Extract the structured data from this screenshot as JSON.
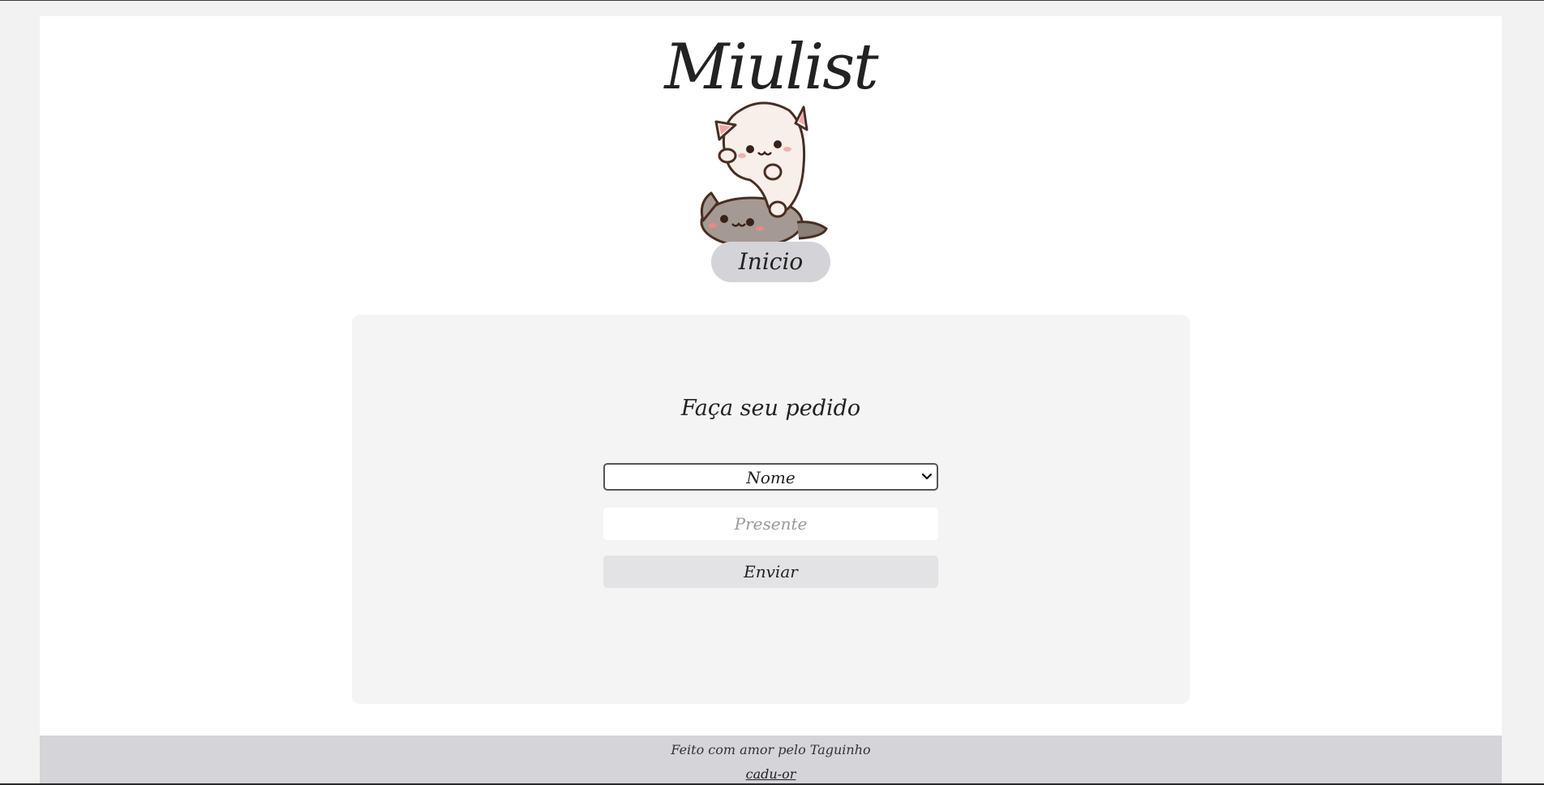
{
  "header": {
    "title": "Miulist",
    "home_label": "Inicio"
  },
  "form": {
    "heading": "Faça seu pedido",
    "name_select_value": "Nome",
    "gift_placeholder": "Presente",
    "submit_label": "Enviar"
  },
  "footer": {
    "credit": "Feito com amor pelo Taguinho",
    "link": "cadu-or"
  },
  "icons": {
    "mascot": "two-cats-illustration-icon",
    "select": "chevron-down-icon"
  },
  "colors": {
    "home_button_bg": "#d3d3d8",
    "card_bg": "#f4f4f4",
    "send_button_bg": "#e3e3e5",
    "footer_bg": "#d4d4d9"
  }
}
